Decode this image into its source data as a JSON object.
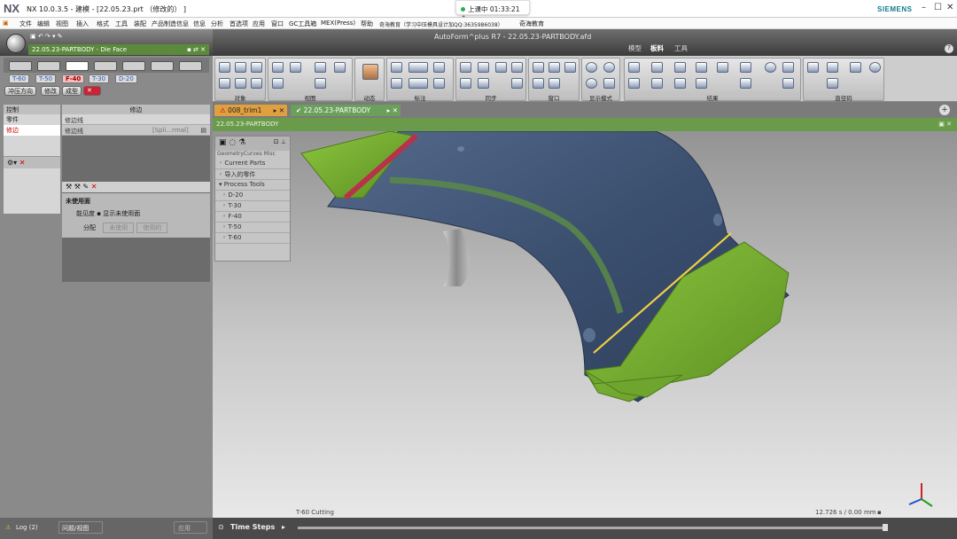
{
  "nx": {
    "logo": "NX",
    "title": "NX 10.0.3.5 - 建模 - [22.05.23.prt （修改的） ]",
    "live_status": "上课中 01:33:21",
    "brand": "SIEMENS",
    "menu": [
      "文件",
      "编辑",
      "视图",
      "插入",
      "格式",
      "工具",
      "装配",
      "产品制造信息",
      "信息",
      "分析",
      "首选项",
      "应用",
      "窗口",
      "GC工具箱",
      "MEX(Press)",
      "帮助",
      "奇海教育（学习中压模具设计加QQ:3635986038）",
      "奇海教育"
    ]
  },
  "af": {
    "title": "AutoForm^plus R7 - 22.05.23-PARTBODY.afd",
    "body_label": "22.05.23-PARTBODY - Die Face",
    "ribbon_tabs": [
      "模型",
      "板料",
      "工具"
    ],
    "active_ribbon_tab": "板料",
    "ribbon_groups": [
      "对象",
      "视图",
      "动态",
      "标注",
      "同步",
      "窗口",
      "显示模式",
      "结果",
      "直径码"
    ]
  },
  "left": {
    "op_buttons": [
      "T-60",
      "T-50",
      "F-40",
      "T-30",
      "D-20"
    ],
    "selected_op": "F-40",
    "actions": [
      "冲压方向",
      "修改",
      "成型"
    ],
    "control": {
      "header": "控制",
      "items": [
        "零件",
        "修边"
      ],
      "selected": "修边"
    },
    "trim": {
      "header": "修边",
      "items": [
        {
          "name": "修边线",
          "value": ""
        },
        {
          "name": "修边线",
          "value": "[Spli...rmal]"
        }
      ]
    },
    "unused": {
      "title": "未使用面",
      "visibility_label": "能见度",
      "show_unused": "显示未使用面",
      "assign_label": "分配",
      "unused_btn": "未使用",
      "used_btn": "使用的"
    },
    "log": "Log (2)",
    "issue": "问题/视图",
    "apply": "应用"
  },
  "tabs": [
    {
      "label": "008_trim1",
      "warn": true
    },
    {
      "label": "22.05.23-PARTBODY",
      "active": true
    }
  ],
  "view": {
    "header": "22.05.23-PARTBODY",
    "tree_tabs": [
      "Geometry",
      "Curves",
      "Misc"
    ],
    "tree": [
      {
        "label": "Current Parts",
        "kind": "head"
      },
      {
        "label": "导入的零件",
        "kind": "head"
      },
      {
        "label": "Process Tools",
        "kind": "open"
      },
      {
        "label": "D-20",
        "kind": "child"
      },
      {
        "label": "T-30",
        "kind": "child"
      },
      {
        "label": "F-40",
        "kind": "child"
      },
      {
        "label": "T-50",
        "kind": "child"
      },
      {
        "label": "T-60",
        "kind": "child"
      }
    ],
    "step_label": "T-60 Cutting",
    "time_readout": "12.726 s / 0.00 mm",
    "time_steps": "Time Steps"
  },
  "colors": {
    "trim_green": "#6aa52b",
    "part_blue": "#3f5575",
    "header_green": "#6a9b4a",
    "trim_line": "#f0d040"
  }
}
